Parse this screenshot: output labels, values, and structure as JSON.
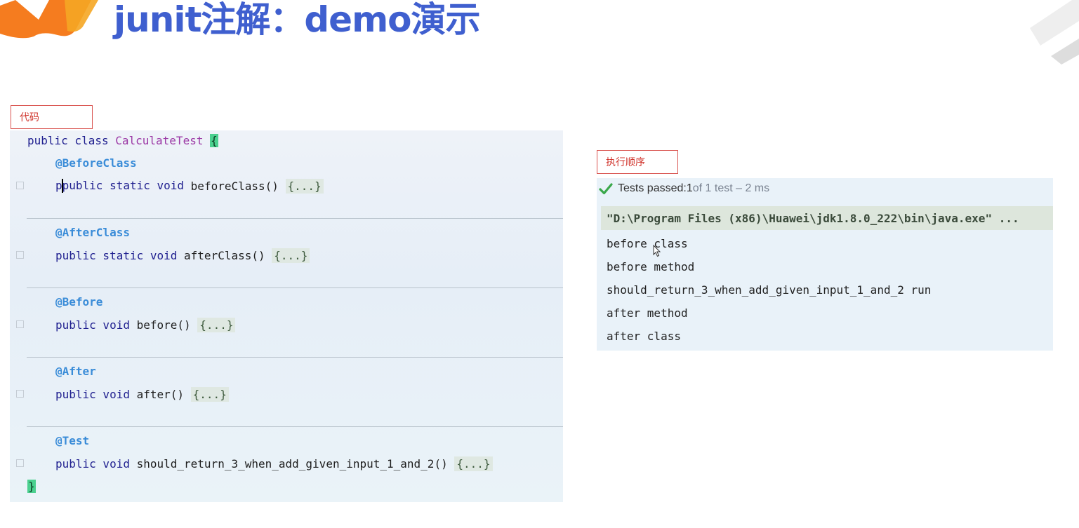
{
  "slide": {
    "title": "junit注解：demo演示"
  },
  "code_tag": "代码",
  "order_tag": "执行顺序",
  "code": {
    "class_line": {
      "kw": "public class ",
      "name": "CalculateTest",
      "open": "{"
    },
    "blocks": [
      {
        "annotation": "@BeforeClass",
        "kw": "public static void ",
        "method": "beforeClass() ",
        "body": "{...}"
      },
      {
        "annotation": "@AfterClass",
        "kw": "public static void ",
        "method": "afterClass() ",
        "body": "{...}"
      },
      {
        "annotation": "@Before",
        "kw": "public void ",
        "method": "before() ",
        "body": "{...}"
      },
      {
        "annotation": "@After",
        "kw": "public void ",
        "method": "after() ",
        "body": "{...}"
      },
      {
        "annotation": "@Test",
        "kw": "public void ",
        "method": "should_return_3_when_add_given_input_1_and_2() ",
        "body": "{...}"
      }
    ],
    "close": "}"
  },
  "results": {
    "status_prefix": "Tests passed: ",
    "passed": "1",
    "status_suffix": " of 1 test – 2 ms",
    "command": "\"D:\\Program Files (x86)\\Huawei\\jdk1.8.0_222\\bin\\java.exe\" ...",
    "lines": [
      "before class",
      "before method",
      "should_return_3_when_add_given_input_1_and_2 run",
      "after method",
      "after class"
    ]
  },
  "colors": {
    "title": "#3f5fcf",
    "accent_orange": "#f57c1f",
    "tag_border": "#d9534f",
    "pass_green": "#3aa84a"
  },
  "icons": [
    "logo-shape",
    "check-icon",
    "cursor-icon"
  ]
}
